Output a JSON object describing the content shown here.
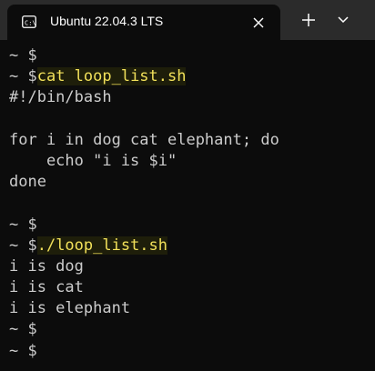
{
  "window": {
    "tab_title": "Ubuntu 22.04.3 LTS",
    "tab_icon": "terminal-icon",
    "close_icon": "close-icon",
    "new_tab_icon": "plus-icon",
    "dropdown_icon": "chevron-down-icon"
  },
  "terminal": {
    "lines": [
      {
        "prompt": "~ $",
        "command": ""
      },
      {
        "prompt": "~ $",
        "command": "cat loop_list.sh"
      },
      {
        "prompt": "",
        "text": "#!/bin/bash"
      },
      {
        "prompt": "",
        "text": ""
      },
      {
        "prompt": "",
        "text": "for i in dog cat elephant; do"
      },
      {
        "prompt": "",
        "text": "    echo \"i is $i\""
      },
      {
        "prompt": "",
        "text": "done"
      },
      {
        "prompt": "",
        "text": ""
      },
      {
        "prompt": "~ $",
        "command": ""
      },
      {
        "prompt": "~ $",
        "command": "./loop_list.sh"
      },
      {
        "prompt": "",
        "text": "i is dog"
      },
      {
        "prompt": "",
        "text": "i is cat"
      },
      {
        "prompt": "",
        "text": "i is elephant"
      },
      {
        "prompt": "~ $",
        "command": ""
      },
      {
        "prompt": "~ $",
        "command": ""
      }
    ]
  },
  "colors": {
    "background": "#0c0c0c",
    "titlebar": "#2b2b2b",
    "text": "#cccccc",
    "highlight_text": "#f1e05a"
  }
}
